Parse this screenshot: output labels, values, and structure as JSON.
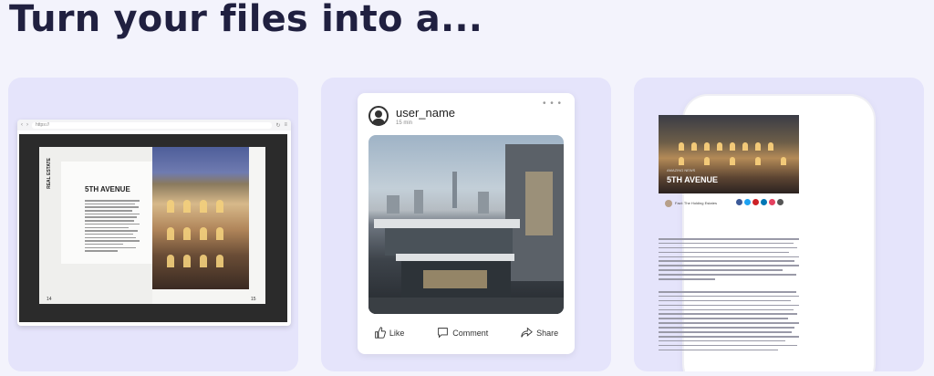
{
  "heading": "Turn your files into a...",
  "flipbook": {
    "browser_url": "https://",
    "side_label": "REAL ESTATE",
    "title": "5TH AVENUE",
    "page_left_number": "14",
    "page_right_number": "15"
  },
  "social_post": {
    "username": "user_name",
    "time": "15 min",
    "more": "• • •",
    "like_label": "Like",
    "comment_label": "Comment",
    "share_label": "Share"
  },
  "mobile_article": {
    "kicker": "AMAZING NEWS",
    "title": "5TH AVENUE",
    "author": "Fact: The Holding Estates",
    "social_colors": [
      "#3b5998",
      "#1da1f2",
      "#cc2127",
      "#0077b5",
      "#e4405f",
      "#555555"
    ]
  }
}
